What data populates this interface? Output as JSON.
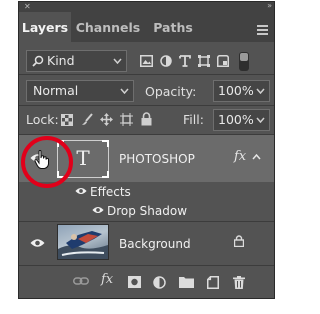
{
  "tabs": [
    {
      "label": "Layers",
      "active": true
    },
    {
      "label": "Channels",
      "active": false
    },
    {
      "label": "Paths",
      "active": false
    }
  ],
  "filter": {
    "kind_label": "Kind"
  },
  "blend": {
    "mode": "Normal",
    "opacity_label": "Opacity:",
    "opacity_value": "100%"
  },
  "lock": {
    "label": "Lock:",
    "fill_label": "Fill:",
    "fill_value": "100%"
  },
  "layers": {
    "text_layer": {
      "name": "PHOTOSHOP",
      "thumb_glyph": "T",
      "fx_label": "fx"
    },
    "effects_label": "Effects",
    "drop_shadow_label": "Drop Shadow",
    "background": {
      "name": "Background"
    }
  },
  "bottom": {
    "fx_label": "fx"
  },
  "colors": {
    "panel_bg": "#535353",
    "tabbar_bg": "#424242",
    "selected_row": "#6b6b6b",
    "highlight_ring": "#e1001a"
  }
}
